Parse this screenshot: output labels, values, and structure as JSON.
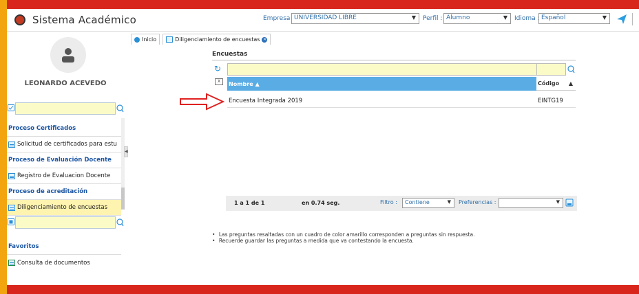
{
  "header": {
    "app_title": "Sistema Académico",
    "empresa_label": "Empresa :",
    "empresa_value": "UNIVERSIDAD LIBRE",
    "perfil_label": "Perfil :",
    "perfil_value": "Alumno",
    "idioma_label": "Idioma :",
    "idioma_value": "Español"
  },
  "sidebar": {
    "user_name": "LEONARDO ACEVEDO",
    "items": [
      {
        "label": "Proceso Certificados",
        "kind": "group"
      },
      {
        "label": "Solicitud de certificados para estu",
        "kind": "item"
      },
      {
        "label": "Proceso de Evaluación Docente",
        "kind": "group"
      },
      {
        "label": "Registro de Evaluacion Docente",
        "kind": "item"
      },
      {
        "label": "Proceso de acreditación",
        "kind": "group"
      },
      {
        "label": "Diligenciamiento de encuestas",
        "kind": "item",
        "selected": true
      }
    ],
    "favorites_title": "Favoritos",
    "favorites": [
      {
        "label": "Consulta de documentos"
      }
    ]
  },
  "tabs": [
    {
      "label": "Inicio"
    },
    {
      "label": "Diligenciamiento de encuestas"
    }
  ],
  "grid": {
    "title": "Encuestas",
    "columns": [
      "Nombre",
      "Código"
    ],
    "rows": [
      {
        "nombre": "Encuesta Integrada 2019",
        "codigo": "EINTG19"
      }
    ],
    "record_count": "1 a 1 de 1",
    "elapsed": "en 0.74 seg.",
    "filter_label": "Filtro :",
    "filter_value": "Contiene",
    "prefs_label": "Preferencias :",
    "prefs_value": ""
  },
  "notes": [
    "Las preguntas resaltadas con un cuadro de color amarillo corresponden a preguntas sin respuesta.",
    "Recuerde guardar las preguntas a medida que va contestando la encuesta."
  ],
  "colors": {
    "frame": "#d9261c",
    "accent": "#2a8fd6",
    "header_blue": "#5aace4",
    "highlight": "#fbfbc8",
    "selected_menu": "#fff3b0"
  }
}
